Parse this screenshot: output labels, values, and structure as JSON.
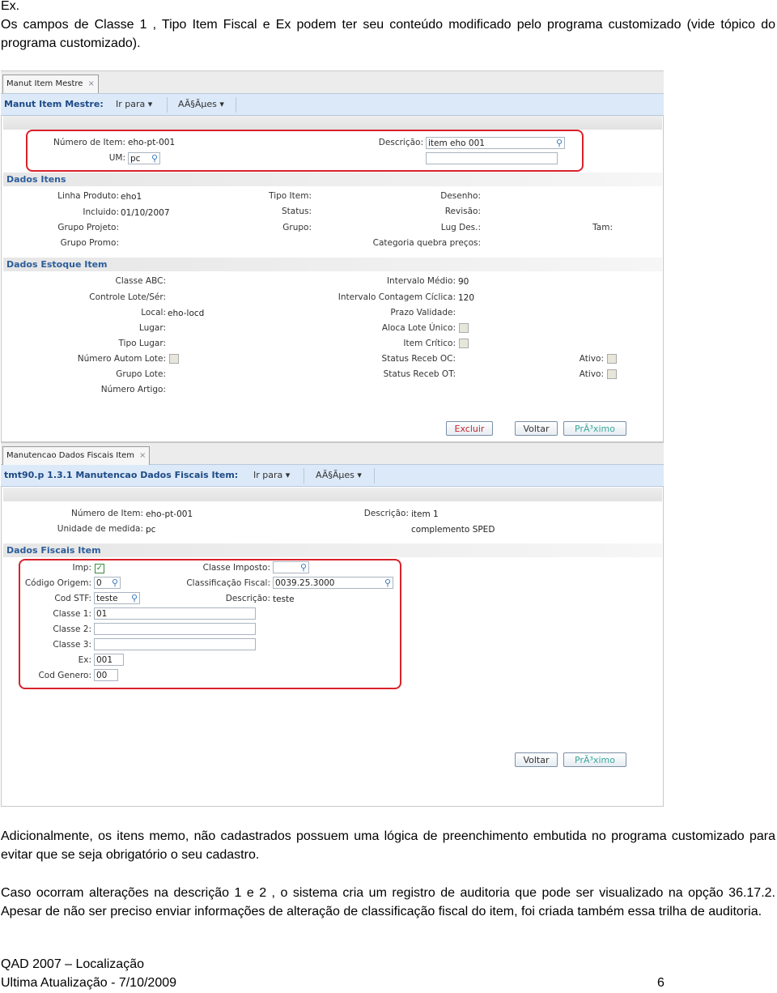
{
  "intro": {
    "ex": "Ex.",
    "text": "Os campos de Classe 1 , Tipo Item Fiscal e Ex podem ter seu conteúdo modificado pelo programa customizado (vide tópico do programa customizado)."
  },
  "shot1": {
    "tab": "Manut Item Mestre",
    "tab_close": "×",
    "title": "Manut Item Mestre:",
    "menu_goto": "Ir para ▾",
    "menu_actions": "AÃ§Ãµes ▾",
    "numero_label": "Número de Item:",
    "numero_value": "eho-pt-001",
    "um_label": "UM:",
    "um_value": "pc",
    "descricao_label": "Descrição:",
    "descricao_value": "item eho 001",
    "descricao2_value": "",
    "section_itens": "Dados Itens",
    "linha_label": "Linha Produto:",
    "linha_value": "eho1",
    "incluido_label": "Incluido:",
    "incluido_value": "01/10/2007",
    "grupo_projeto_label": "Grupo Projeto:",
    "grupo_promo_label": "Grupo Promo:",
    "tipo_item_label": "Tipo Item:",
    "status_label": "Status:",
    "grupo_label": "Grupo:",
    "desenho_label": "Desenho:",
    "revisao_label": "Revisão:",
    "lug_des_label": "Lug Des.:",
    "categoria_label": "Categoria quebra preços:",
    "tam_label": "Tam:",
    "section_estoque": "Dados Estoque Item",
    "classe_abc_label": "Classe ABC:",
    "controle_label": "Controle Lote/Sér:",
    "local_label": "Local:",
    "local_value": "eho-locd",
    "lugar_label": "Lugar:",
    "tipo_lugar_label": "Tipo Lugar:",
    "num_autom_label": "Número Autom Lote:",
    "grupo_lote_label": "Grupo Lote:",
    "num_artigo_label": "Número Artigo:",
    "int_medio_label": "Intervalo Médio:",
    "int_medio_value": "90",
    "int_contagem_label": "Intervalo Contagem Cíclica:",
    "int_contagem_value": "120",
    "prazo_label": "Prazo Validade:",
    "aloca_label": "Aloca Lote Único:",
    "critico_label": "Item Crítico:",
    "receb_oc_label": "Status Receb OC:",
    "receb_ot_label": "Status Receb OT:",
    "ativo_label": "Ativo:",
    "btn_excluir": "Excluir",
    "btn_voltar": "Voltar",
    "btn_proximo": "PrÃ³ximo"
  },
  "shot2": {
    "tab": "Manutencao Dados Fiscais Item",
    "tab_close": "×",
    "title": "tmt90.p 1.3.1 Manutencao Dados Fiscais Item:",
    "menu_goto": "Ir para ▾",
    "menu_actions": "AÃ§Ãµes ▾",
    "numero_label": "Número de Item:",
    "numero_value": "eho-pt-001",
    "unidade_label": "Unidade de medida:",
    "unidade_value": "pc",
    "descricao_label": "Descrição:",
    "descricao_value": "item 1",
    "complemento": "complemento SPED",
    "section_fiscais": "Dados Fiscais Item",
    "imp_label": "Imp:",
    "imp_checked": true,
    "origem_label": "Código Origem:",
    "origem_value": "0",
    "stf_label": "Cod STF:",
    "stf_value": "teste",
    "classe1_label": "Classe 1:",
    "classe1_value": "01",
    "classe2_label": "Classe 2:",
    "classe2_value": "",
    "classe3_label": "Classe 3:",
    "classe3_value": "",
    "ex_label": "Ex:",
    "ex_value": "001",
    "genero_label": "Cod Genero:",
    "genero_value": "00",
    "classe_imposto_label": "Classe Imposto:",
    "classe_imposto_value": "",
    "class_fiscal_label": "Classificação Fiscal:",
    "class_fiscal_value": "0039.25.3000",
    "desc_label": "Descrição:",
    "desc_value": "teste",
    "btn_voltar": "Voltar",
    "btn_proximo": "PrÃ³ximo"
  },
  "body": {
    "p1": "Adicionalmente, os itens memo, não cadastrados possuem uma lógica de preenchimento embutida no programa customizado para evitar que se seja obrigatório o seu cadastro.",
    "p2": "Caso ocorram alterações na descrição 1 e 2 , o sistema cria um registro de auditoria que pode ser visualizado na opção 36.17.2. Apesar de não ser preciso enviar informações de alteração de classificação fiscal do item, foi criada também essa trilha de auditoria."
  },
  "footer": {
    "line1": "QAD 2007 – Localização",
    "line2": "Ultima Atualização - 7/10/2009",
    "page": "6"
  },
  "colors": {
    "highlight": "#d9222a",
    "toolbar": "#dce9f8",
    "section_title": "#2c5d9a"
  }
}
